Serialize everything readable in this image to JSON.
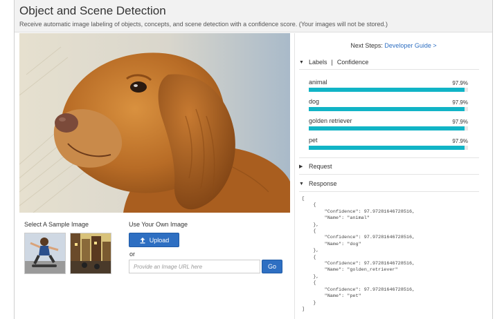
{
  "header": {
    "title": "Object and Scene Detection",
    "subtitle": "Receive automatic image labeling of objects, concepts, and scene detection with a confidence score. (Your images will not be stored.)"
  },
  "samples": {
    "title": "Select A Sample Image"
  },
  "own_image": {
    "title": "Use Your Own Image",
    "upload_label": "Upload",
    "or_text": "or",
    "url_placeholder": "Provide an Image URL here",
    "go_label": "Go"
  },
  "next_steps": {
    "prefix": "Next Steps:",
    "link": "Developer Guide >"
  },
  "labels_section": {
    "title": "Labels",
    "separator": "|",
    "subtitle": "Confidence",
    "items": [
      {
        "name": "animal",
        "confidence_text": "97.9%",
        "confidence": 97.9
      },
      {
        "name": "dog",
        "confidence_text": "97.9%",
        "confidence": 97.9
      },
      {
        "name": "golden retriever",
        "confidence_text": "97.9%",
        "confidence": 97.9
      },
      {
        "name": "pet",
        "confidence_text": "97.9%",
        "confidence": 97.9
      }
    ]
  },
  "request_section": {
    "title": "Request"
  },
  "response_section": {
    "title": "Response",
    "json_text": "[\n    {\n        \"Confidence\": 97.97281646728516,\n        \"Name\": \"animal\"\n    },\n    {\n        \"Confidence\": 97.97281646728516,\n        \"Name\": \"dog\"\n    },\n    {\n        \"Confidence\": 97.97281646728516,\n        \"Name\": \"golden_retriever\"\n    },\n    {\n        \"Confidence\": 97.97281646728516,\n        \"Name\": \"pet\"\n    }\n]"
  },
  "colors": {
    "accent_blue": "#2e6fc2",
    "bar_teal": "#11b4c6",
    "header_bg": "#f2f2f2"
  },
  "icons": {
    "upload": "upload-icon",
    "expanded": "triangle-down-icon",
    "collapsed": "triangle-right-icon"
  }
}
